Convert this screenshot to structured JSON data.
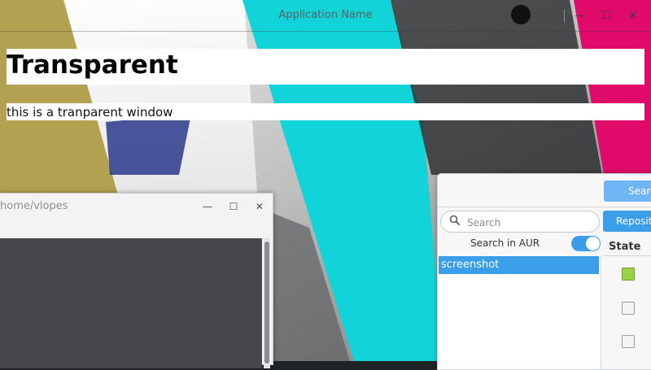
{
  "app_window": {
    "title": "Application Name",
    "controls": {
      "minimize": "—",
      "maximize": "☐",
      "close": "✕"
    },
    "heading": "Transparent",
    "subtitle": "this is a tranparent window"
  },
  "terminal_window": {
    "title": "home/vlopes",
    "controls": {
      "minimize": "—",
      "maximize": "☐",
      "close": "✕"
    }
  },
  "package_window": {
    "search_button": "Search",
    "search_placeholder": "Search",
    "aur_label": "Search in AUR",
    "aur_enabled": true,
    "packages": [
      "screenshot"
    ],
    "repo_button": "Repositories",
    "state_header": "State",
    "accent_color": "#3a9ee8"
  },
  "wallpaper_colors": {
    "gold": "#b3a152",
    "cyan": "#12d4d8",
    "magenta": "#e00a6a"
  }
}
